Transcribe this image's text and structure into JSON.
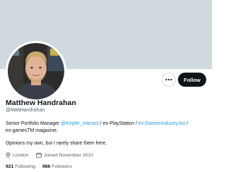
{
  "profile": {
    "name": "Matthew Handrahan",
    "handle": "@MattHandrahan",
    "bio": {
      "line1_prefix": "Senior Portfolio Manager ",
      "link1": "@Kepler_Interact",
      "line1_mid": " / ex-PlayStation / ",
      "link2": "ex-GamesIndustry.biz",
      "line1_suffix": " /",
      "line2": "ex-gamesTM magazine.",
      "line3": "Opinions my own, but I rarely share them here."
    },
    "location": "London",
    "joined": "Joined November 2010",
    "following_count": "921",
    "following_label": "Following",
    "followers_count": "986",
    "followers_label": "Followers"
  },
  "actions": {
    "follow_label": "Follow",
    "more_icon": "more-horizontal-icon"
  },
  "colors": {
    "banner": "#cfd9de",
    "accent": "#1d9bf0",
    "text": "#0f1419",
    "secondary": "#536471"
  }
}
